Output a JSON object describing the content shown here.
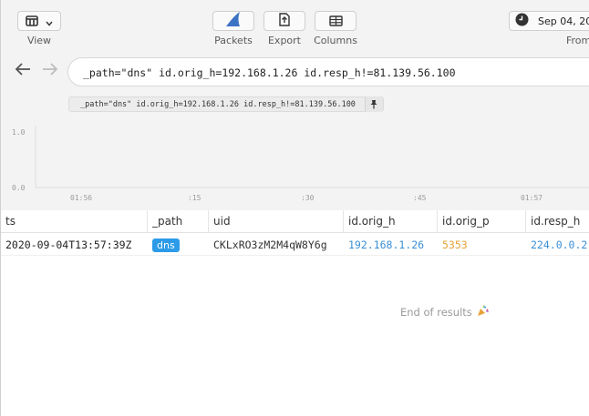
{
  "toolbar": {
    "view_label": "View",
    "packets_label": "Packets",
    "export_label": "Export",
    "columns_label": "Columns",
    "from_label": "From",
    "date_text": "Sep 04, 20",
    "icons": {
      "view": "window-layout-icon",
      "chevron": "chevron-down-icon",
      "packets": "shark-fin-icon",
      "export": "file-export-icon",
      "columns": "table-columns-icon",
      "date": "clock-icon"
    }
  },
  "nav": {
    "back_icon": "arrow-left-icon",
    "forward_icon": "arrow-right-icon"
  },
  "search": {
    "value": "_path=\"dns\" id.orig_h=192.168.1.26 id.resp_h!=81.139.56.100"
  },
  "pinned": {
    "text": "_path=\"dns\" id.orig_h=192.168.1.26 id.resp_h!=81.139.56.100",
    "pin_icon": "pin-icon"
  },
  "histogram": {
    "y_ticks": [
      "1.0",
      "0.0"
    ],
    "x_ticks": [
      "01:56",
      ":15",
      ":30",
      ":45",
      "01:57"
    ]
  },
  "table": {
    "columns": [
      "ts",
      "_path",
      "uid",
      "id.orig_h",
      "id.orig_p",
      "id.resp_h"
    ],
    "rows": [
      {
        "ts": "2020-09-04T13:57:39Z",
        "_path": "dns",
        "uid": "CKLxRO3zM2M4qW8Y6g",
        "id_orig_h": "192.168.1.26",
        "id_orig_p": "5353",
        "id_resp_h": "224.0.0.2"
      }
    ]
  },
  "end_of_results": "End of results",
  "end_icon": "party-popper-icon",
  "colors": {
    "accent_blue": "#2d9be8",
    "ip_blue": "#3a8fd6",
    "port_orange": "#e6a23a",
    "shark_blue": "#3d73c4"
  }
}
